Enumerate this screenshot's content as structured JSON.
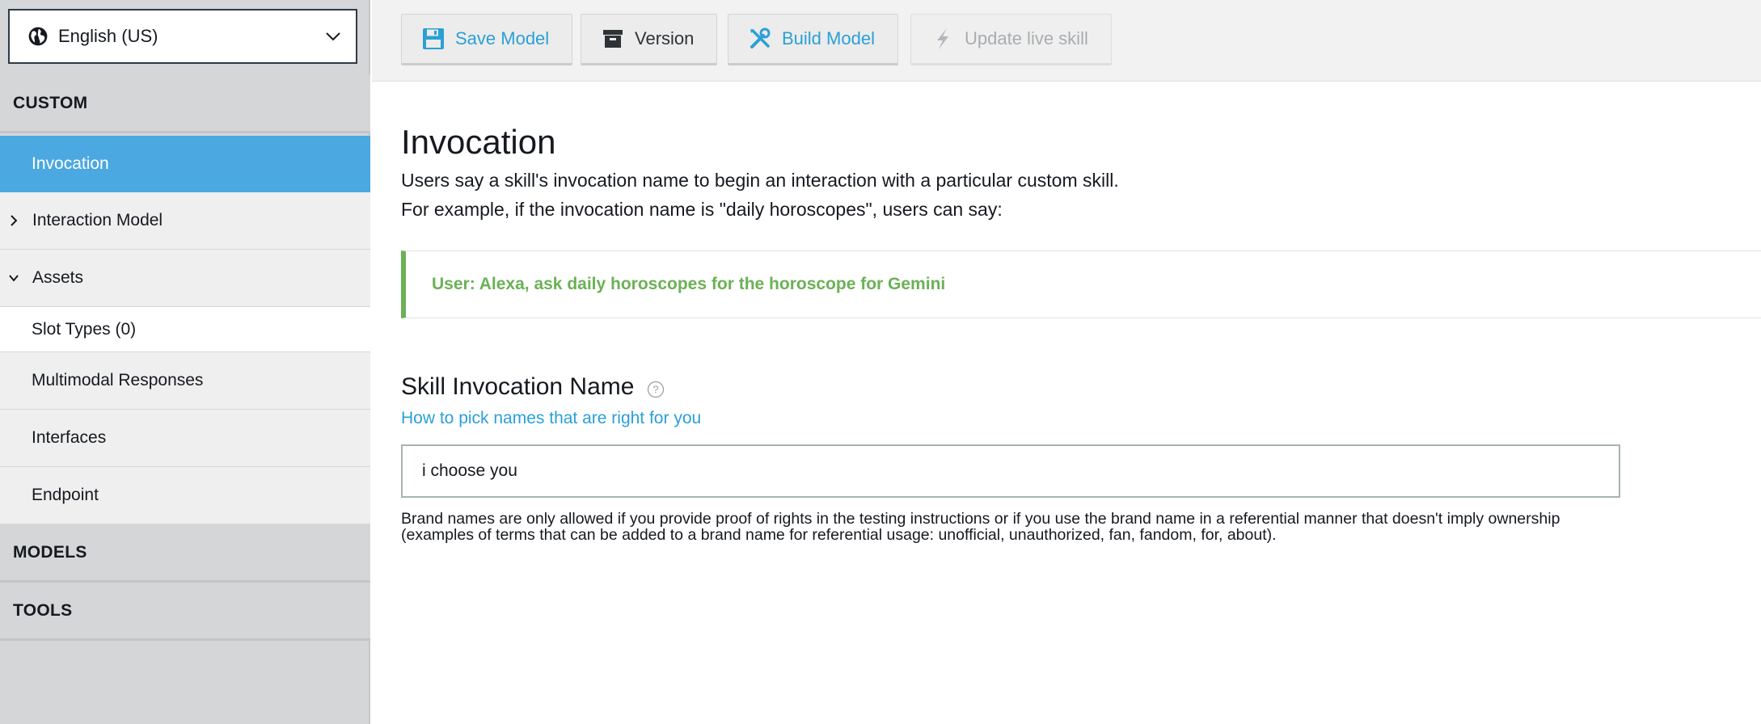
{
  "sidebar": {
    "locale": "English (US)",
    "sections": {
      "custom": "CUSTOM",
      "models": "MODELS",
      "tools": "TOOLS"
    },
    "items": [
      {
        "label": "Invocation",
        "active": true
      },
      {
        "label": "Interaction Model",
        "expandable": true,
        "expanded": false
      },
      {
        "label": "Assets",
        "expandable": true,
        "expanded": true
      },
      {
        "label": "Slot Types (0)"
      },
      {
        "label": "Multimodal Responses"
      },
      {
        "label": "Interfaces"
      },
      {
        "label": "Endpoint"
      }
    ]
  },
  "toolbar": {
    "save_label": "Save Model",
    "version_label": "Version",
    "build_label": "Build Model",
    "update_label": "Update live skill"
  },
  "main": {
    "title": "Invocation",
    "description_1": "Users say a skill's invocation name to begin an interaction with a particular custom skill.",
    "description_2": "For example, if the invocation name is \"daily horoscopes\", users can say:",
    "example_utterance": "User: Alexa, ask daily horoscopes for the horoscope for Gemini",
    "field_label": "Skill Invocation Name",
    "help_link": "How to pick names that are right for you",
    "invocation_name_value": "i choose you",
    "brand_note": "Brand names are only allowed if you provide proof of rights in the testing instructions or if you use the brand name in a referential manner that doesn't imply ownership (examples of terms that can be added to a brand name for referential usage: unofficial, unauthorized, fan, fandom, for, about)."
  },
  "colors": {
    "accent_blue": "#4ba8e0",
    "link_blue": "#2aa0d6",
    "example_green": "#6bb155",
    "sidebar_bg": "#d5d6d8"
  },
  "icons": {
    "locale": "globe-icon",
    "save": "floppy-disk-icon",
    "version": "archive-box-icon",
    "build": "wrench-screwdriver-icon",
    "update": "lightning-icon",
    "help": "question-mark-icon"
  }
}
